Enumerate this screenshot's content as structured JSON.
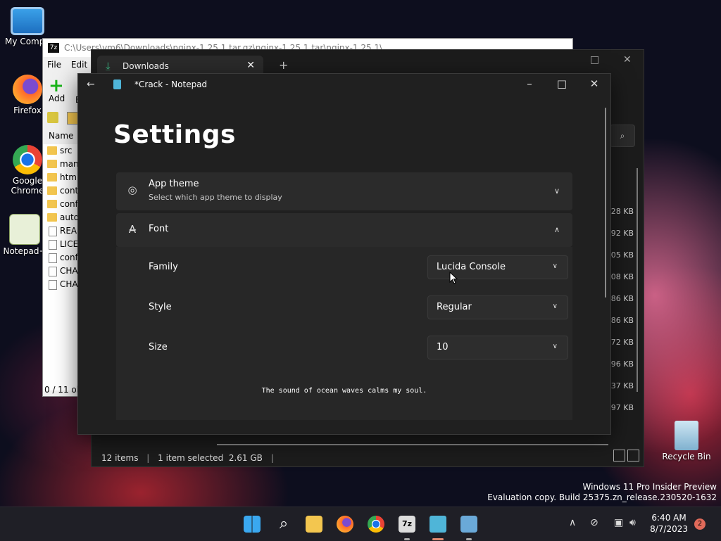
{
  "desktop": {
    "icons": [
      {
        "label": "My Compu",
        "name": "my-computer"
      },
      {
        "label": "Firefox",
        "name": "firefox"
      },
      {
        "label": "Google Chrome",
        "name": "google-chrome"
      },
      {
        "label": "Notepad+",
        "name": "notepad-plus"
      },
      {
        "label": "Recycle Bin",
        "name": "recycle-bin"
      }
    ],
    "watermark_line1": "Windows 11 Pro Insider Preview",
    "watermark_line2": "Evaluation copy. Build 25375.zn_release.230520-1632"
  },
  "sevenzip": {
    "title": "C:\\Users\\vm6\\Downloads\\nginx-1.25.1.tar.gz\\nginx-1.25.1.tar\\nginx-1.25.1\\",
    "logo": "7z",
    "menu": [
      "File",
      "Edit"
    ],
    "add_label": "Add",
    "add_suffix": "E",
    "column_name": "Name",
    "items": [
      "src",
      "man",
      "html",
      "conti",
      "conf",
      "auto",
      "READ",
      "LICEI",
      "confi",
      "CHA",
      "CHA"
    ],
    "item_types": [
      "folder",
      "folder",
      "folder",
      "folder",
      "folder",
      "folder",
      "file",
      "file",
      "file",
      "file",
      "file"
    ],
    "status": "0 / 11 obj"
  },
  "explorer": {
    "tab_title": "Downloads",
    "sizes": [
      "328 KB",
      "792 KB",
      "505 KB",
      "008 KB",
      "186 KB",
      "186 KB",
      "072 KB",
      "96 KB",
      "937 KB",
      "597 KB"
    ],
    "status_items": "12 items",
    "status_selected": "1 item selected  2.61 GB"
  },
  "notepad": {
    "window_title": "*Crack - Notepad",
    "heading": "Settings",
    "app_theme": {
      "label": "App theme",
      "sub": "Select which app theme to display"
    },
    "font": {
      "label": "Font"
    },
    "rows": [
      {
        "label": "Family",
        "value": "Lucida Console"
      },
      {
        "label": "Style",
        "value": "Regular"
      },
      {
        "label": "Size",
        "value": "10"
      }
    ],
    "preview_text": "The sound of ocean waves calms my soul."
  },
  "taskbar": {
    "time": "6:40 AM",
    "date": "8/7/2023",
    "notification_count": "2"
  }
}
